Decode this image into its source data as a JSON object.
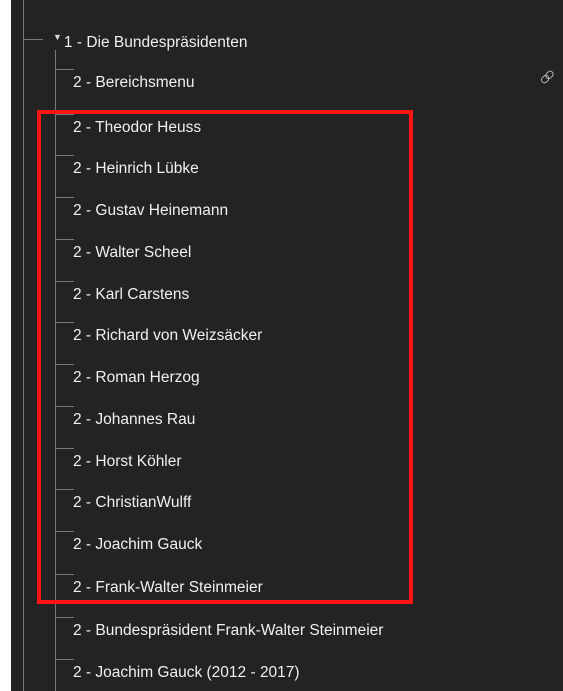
{
  "tree": {
    "root": {
      "label": "1 - Die Bundespräsidenten",
      "expanded_icon": "triangle-down-icon"
    },
    "children": [
      {
        "label": "2 - Bereichsmenu",
        "has_link_icon": true
      },
      {
        "label": "2 - Theodor Heuss"
      },
      {
        "label": "2 - Heinrich Lübke"
      },
      {
        "label": "2 - Gustav Heinemann"
      },
      {
        "label": "2 - Walter Scheel"
      },
      {
        "label": "2 - Karl Carstens"
      },
      {
        "label": "2 - Richard von Weizsäcker"
      },
      {
        "label": "2 - Roman Herzog"
      },
      {
        "label": "2 - Johannes Rau"
      },
      {
        "label": "2 - Horst Köhler"
      },
      {
        "label": "2 - ChristianWulff"
      },
      {
        "label": "2 - Joachim Gauck"
      },
      {
        "label": "2 - Frank-Walter Steinmeier"
      },
      {
        "label": "2 -  Bundespräsident Frank-Walter Steinmeier"
      },
      {
        "label": "2 - Joachim Gauck (2012 - 2017)"
      }
    ]
  },
  "annotation": {
    "color": "#ff1414",
    "covers_items": "2 - Theodor Heuss to 2 - Frank-Walter Steinmeier"
  },
  "colors": {
    "background": "#232323",
    "text": "#f0f0f0",
    "tree_lines": "#7a7a7a"
  }
}
